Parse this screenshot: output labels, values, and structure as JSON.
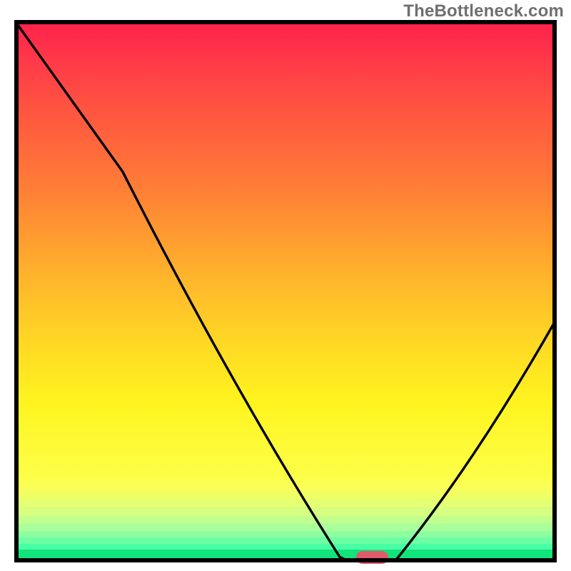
{
  "watermark": "TheBottleneck.com",
  "colors": {
    "frame": "#000000",
    "marker": "#e05a6a",
    "curve": "#000000"
  },
  "chart_data": {
    "type": "line",
    "title": "",
    "xlabel": "",
    "ylabel": "",
    "xlim": [
      0,
      100
    ],
    "ylim": [
      0,
      100
    ],
    "legend": false,
    "grid": false,
    "background": "rainbow-vertical",
    "series": [
      {
        "name": "curve",
        "x": [
          0,
          20,
          60,
          62,
          70,
          100
        ],
        "y": [
          100,
          72,
          1,
          0,
          0,
          45
        ]
      }
    ],
    "marker": {
      "shape": "capsule",
      "cx": 66,
      "cy": 0.9,
      "rx": 3.0,
      "ry": 1.2
    }
  }
}
